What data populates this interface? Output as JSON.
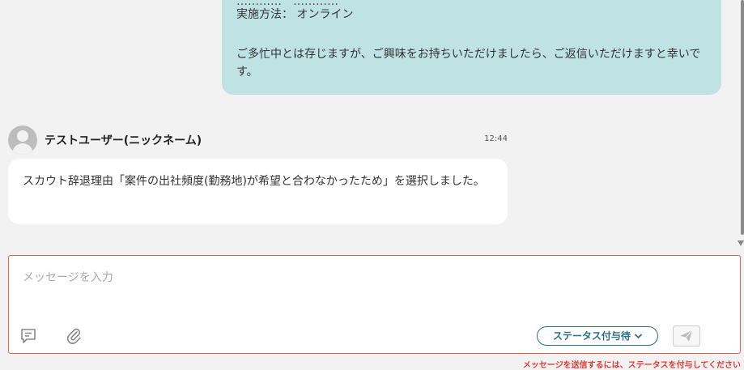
{
  "sent_message": {
    "clipped_line": "…………　…………",
    "method_line": "実施方法： オンライン",
    "body": "ご多忙中とは存じますが、ご興味をお持ちいただけましたら、ご返信いただけますと幸いです。"
  },
  "received_message": {
    "username": "テストユーザー(ニックネーム)",
    "time": "12:44",
    "body": "スカウト辞退理由「案件の出社頻度(勤務地)が希望と合わなかったため」を選択しました。"
  },
  "composer": {
    "placeholder": "メッセージを入力",
    "template_icon": "message-template-icon",
    "attach_icon": "paperclip-icon",
    "status_label": "ステータス付与待",
    "status_chevron": "chevron-down-icon",
    "send_icon": "send-icon"
  },
  "warning": "メッセージを送信するには、ステータスを付与してください",
  "colors": {
    "sent_bubble": "#bfe3e3",
    "accent": "#2a6f86",
    "error": "#e53935"
  }
}
